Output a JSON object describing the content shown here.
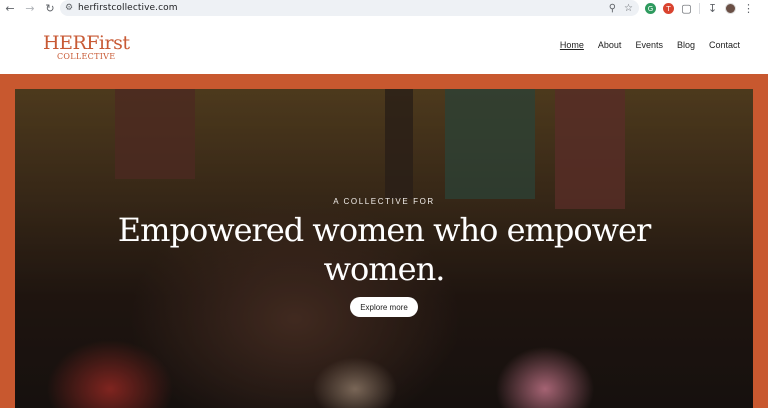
{
  "browser": {
    "url": "herfirstcollective.com",
    "icons": {
      "back": "back-arrow-icon",
      "forward": "forward-arrow-icon",
      "reload": "reload-icon",
      "site_info": "site-info-icon",
      "zoom": "zoom-icon",
      "bookmark": "bookmark-star-icon",
      "extension_1": "grammarly-icon",
      "extension_2": "extension-red-icon",
      "extensions": "puzzle-icon",
      "download": "download-icon",
      "profile": "avatar-icon",
      "menu": "kebab-menu-icon"
    }
  },
  "header": {
    "logo_main": "HERFirst",
    "logo_sub": "COLLECTIVE",
    "nav": [
      {
        "label": "Home"
      },
      {
        "label": "About"
      },
      {
        "label": "Events"
      },
      {
        "label": "Blog"
      },
      {
        "label": "Contact"
      }
    ]
  },
  "hero": {
    "eyebrow": "A COLLECTIVE FOR",
    "headline_line1": "Empowered women who empower",
    "headline_line2": "women.",
    "cta_label": "Explore more"
  },
  "colors": {
    "brand": "#c85a35",
    "hero_frame": "#c8582f"
  }
}
